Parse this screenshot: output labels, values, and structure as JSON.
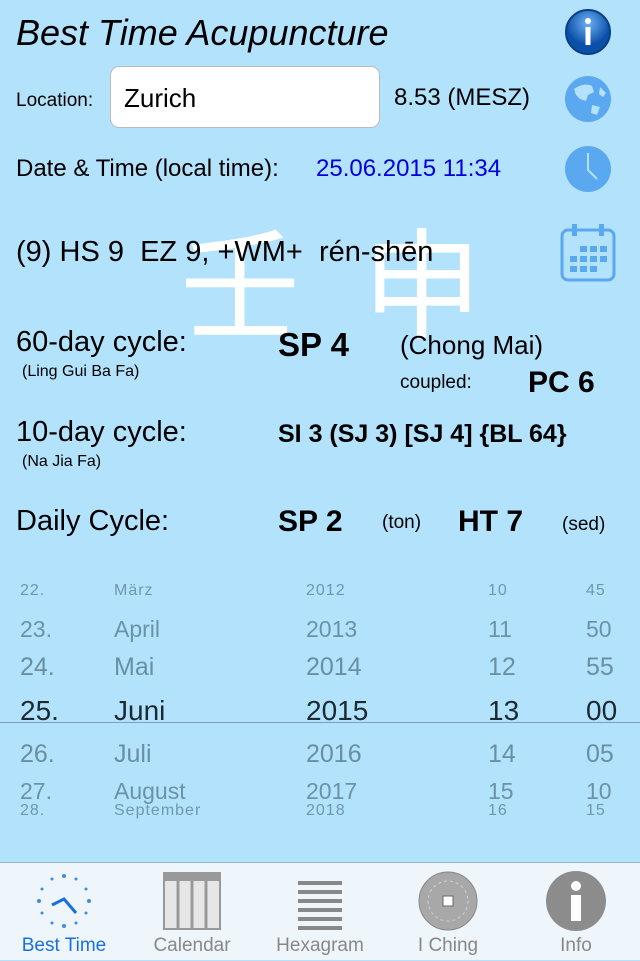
{
  "header": {
    "title": "Best Time Acupuncture",
    "info_icon": "info-icon"
  },
  "location": {
    "label": "Location:",
    "value": "Zurich",
    "longitude": "8.53 (MESZ)",
    "icon": "globe-icon"
  },
  "datetime": {
    "label": "Date & Time (local time):",
    "value": "25.06.2015 11:34",
    "icon": "clock-icon"
  },
  "stem_branch": {
    "text": "(9) HS 9  EZ 9, +WM+  rén-shēn",
    "chars": [
      "壬",
      "申"
    ],
    "icon": "calendar-icon"
  },
  "cycle60": {
    "label": "60-day cycle:",
    "sub": "(Ling Gui Ba Fa)",
    "point": "SP 4",
    "meridian": "(Chong Mai)",
    "coupled_label": "coupled:",
    "coupled": "PC 6"
  },
  "cycle10": {
    "label": "10-day cycle:",
    "sub": "(Na Jia Fa)",
    "points": "SI 3 (SJ 3) [SJ 4] {BL 64}"
  },
  "daily": {
    "label": "Daily Cycle:",
    "ton_point": "SP 2",
    "ton": "(ton)",
    "sed_point": "HT 7",
    "sed": "(sed)"
  },
  "picker": {
    "rows": [
      [
        "22.",
        "März",
        "2012",
        "10",
        "45"
      ],
      [
        "23.",
        "April",
        "2013",
        "11",
        "50"
      ],
      [
        "24.",
        "Mai",
        "2014",
        "12",
        "55"
      ],
      [
        "25.",
        "Juni",
        "2015",
        "13",
        "00"
      ],
      [
        "26.",
        "Juli",
        "2016",
        "14",
        "05"
      ],
      [
        "27.",
        "August",
        "2017",
        "15",
        "10"
      ],
      [
        "28.",
        "September",
        "2018",
        "16",
        "15"
      ]
    ],
    "selected_index": 3
  },
  "tabs": [
    {
      "label": "Best Time",
      "active": true
    },
    {
      "label": "Calendar"
    },
    {
      "label": "Hexagram"
    },
    {
      "label": "I Ching"
    },
    {
      "label": "Info"
    }
  ],
  "colors": {
    "background": "#b3e2fc",
    "accent": "#1a6fe0",
    "date_value": "#0000dd",
    "icon": "#5aa8f0"
  }
}
